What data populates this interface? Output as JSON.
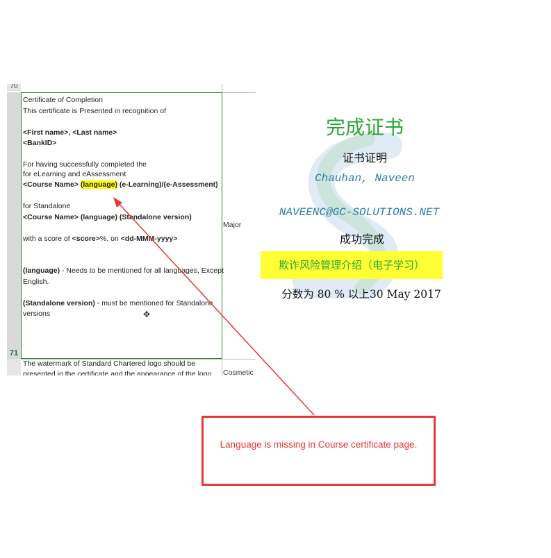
{
  "sheet": {
    "prev_row_number": "70",
    "row_number": "71",
    "cell_lines": {
      "l1": "Certificate of Completion",
      "l2": "This certificate is Presented in recognition of",
      "l3": "<First name>, <Last name>",
      "l4": "<BankID>",
      "l5": "For having successfully completed the",
      "l6": "for eLearning and eAssessment",
      "l7a": "<Course Name> ",
      "l7_hl": "(language)",
      "l7b": " (e-Learning)/(e-Assessment)",
      "l8": "for Standalone",
      "l9": "<Course Name>  (language) (Standalone version)",
      "l10a": "with a score of ",
      "l10b": "<score>",
      "l10c": "%, on ",
      "l10d": "<dd-MMM-yyyy>",
      "l11a": "(language)",
      "l11b": " - Needs to be mentioned for all languages, Except English.",
      "l12a": "(Standalone version)",
      "l12b": " - must be mentioned for Standalone versions"
    },
    "severity": "Major",
    "next_row_text": "The watermark of Standard Chartered logo should be presented in the certificate and the appearance of the logo should not be",
    "next_severity": "Cosmetic"
  },
  "certificate": {
    "title": "完成证书",
    "certifies": "证书证明",
    "name": "Chauhan, Naveen",
    "email": "NAVEENC@GC-SOLUTIONS.NET",
    "completed": "成功完成",
    "course": "欺诈风险管理介绍（电子学习）",
    "score_line": "分数为 80 % 以上30 May 2017",
    "title_color": "#2aa636",
    "highlight_color": "#ffff33",
    "watermark_icon": "watermark-s-logo-icon"
  },
  "annotation": {
    "callout_text": "Language is missing in Course certificate page.",
    "color": "#e53935",
    "arrow_icon": "arrow-icon"
  }
}
